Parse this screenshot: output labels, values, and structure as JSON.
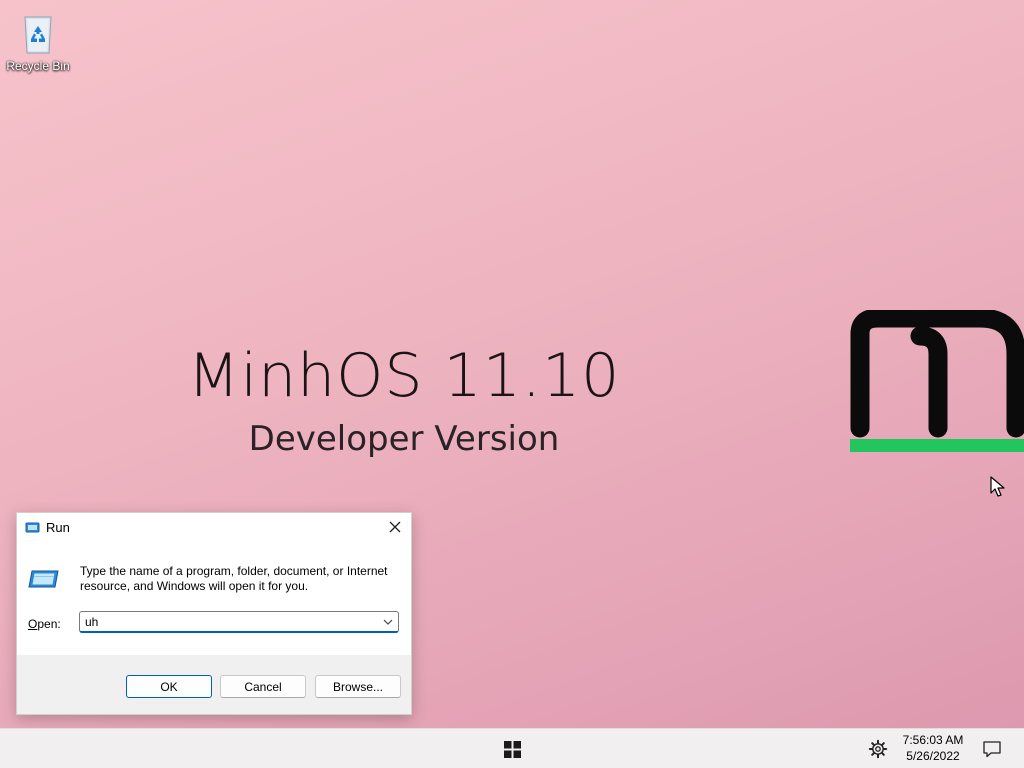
{
  "desktop": {
    "icons": [
      {
        "label": "Recycle Bin",
        "icon": "recycle-bin-icon"
      }
    ]
  },
  "wallpaper": {
    "title": "MinhOS 11.10",
    "subtitle": "Developer Version",
    "logo_letter": "m",
    "logo_colors": {
      "glyph": "#0b0b0b",
      "underline": "#22c55e"
    }
  },
  "run_dialog": {
    "title": "Run",
    "description": "Type the name of a program, folder, document, or Internet resource, and Windows will open it for you.",
    "open_label": "Open:",
    "open_value": "uh",
    "buttons": {
      "ok": "OK",
      "cancel": "Cancel",
      "browse": "Browse..."
    },
    "accent": "#005fb8"
  },
  "taskbar": {
    "time": "7:56:03 AM",
    "date": "5/26/2022",
    "start_icon": "windows-logo-icon",
    "settings_icon": "gear-icon",
    "notifications_icon": "notification-icon"
  }
}
